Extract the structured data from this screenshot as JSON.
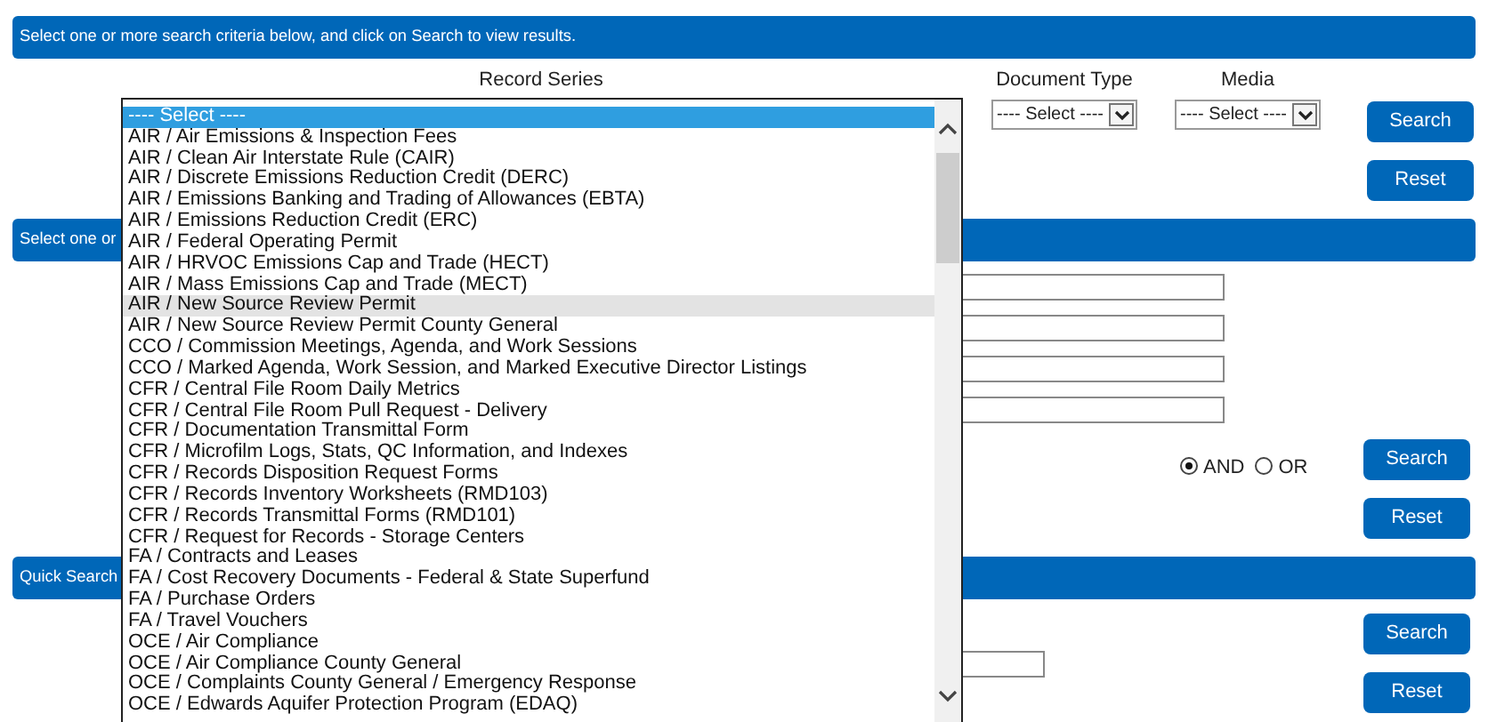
{
  "search_panel": {
    "banner": "Select one or more search criteria below, and click on Search to view results.",
    "record_series": {
      "label": "Record Series"
    },
    "document_type": {
      "label": "Document Type",
      "value": "---- Select ----"
    },
    "media": {
      "label": "Media",
      "value": "---- Select ----"
    },
    "buttons": [
      "Search",
      "Reset"
    ]
  },
  "advanced_panel": {
    "banner": "Select one or",
    "logic_options": [
      {
        "label": "AND",
        "selected": true
      },
      {
        "label": "OR",
        "selected": false
      }
    ],
    "buttons": [
      "Search",
      "Reset"
    ]
  },
  "quick_panel": {
    "banner": "Quick Search",
    "buttons": [
      "Search",
      "Reset"
    ]
  },
  "record_series_list": {
    "items": [
      {
        "label": "---- Select ----",
        "selected": true,
        "hovered": false
      },
      {
        "label": "AIR / Air Emissions & Inspection Fees",
        "selected": false,
        "hovered": false
      },
      {
        "label": "AIR / Clean Air Interstate Rule (CAIR)",
        "selected": false,
        "hovered": false
      },
      {
        "label": "AIR / Discrete Emissions Reduction Credit (DERC)",
        "selected": false,
        "hovered": false
      },
      {
        "label": "AIR / Emissions Banking and Trading of Allowances (EBTA)",
        "selected": false,
        "hovered": false
      },
      {
        "label": "AIR / Emissions Reduction Credit (ERC)",
        "selected": false,
        "hovered": false
      },
      {
        "label": "AIR / Federal Operating Permit",
        "selected": false,
        "hovered": false
      },
      {
        "label": "AIR / HRVOC Emissions Cap and Trade (HECT)",
        "selected": false,
        "hovered": false
      },
      {
        "label": "AIR / Mass Emissions Cap and Trade (MECT)",
        "selected": false,
        "hovered": false
      },
      {
        "label": "AIR / New Source Review Permit",
        "selected": false,
        "hovered": true
      },
      {
        "label": "AIR / New Source Review Permit County General",
        "selected": false,
        "hovered": false
      },
      {
        "label": "CCO / Commission Meetings, Agenda, and Work Sessions",
        "selected": false,
        "hovered": false
      },
      {
        "label": "CCO / Marked Agenda, Work Session, and Marked Executive Director Listings",
        "selected": false,
        "hovered": false
      },
      {
        "label": "CFR / Central File Room Daily Metrics",
        "selected": false,
        "hovered": false
      },
      {
        "label": "CFR / Central File Room Pull Request - Delivery",
        "selected": false,
        "hovered": false
      },
      {
        "label": "CFR / Documentation Transmittal Form",
        "selected": false,
        "hovered": false
      },
      {
        "label": "CFR / Microfilm Logs, Stats, QC Information, and Indexes",
        "selected": false,
        "hovered": false
      },
      {
        "label": "CFR / Records Disposition Request Forms",
        "selected": false,
        "hovered": false
      },
      {
        "label": "CFR / Records Inventory Worksheets (RMD103)",
        "selected": false,
        "hovered": false
      },
      {
        "label": "CFR / Records Transmittal Forms (RMD101)",
        "selected": false,
        "hovered": false
      },
      {
        "label": "CFR / Request for Records - Storage Centers",
        "selected": false,
        "hovered": false
      },
      {
        "label": "FA / Contracts and Leases",
        "selected": false,
        "hovered": false
      },
      {
        "label": "FA / Cost Recovery Documents - Federal & State Superfund",
        "selected": false,
        "hovered": false
      },
      {
        "label": "FA / Purchase Orders",
        "selected": false,
        "hovered": false
      },
      {
        "label": "FA / Travel Vouchers",
        "selected": false,
        "hovered": false
      },
      {
        "label": "OCE / Air Compliance",
        "selected": false,
        "hovered": false
      },
      {
        "label": "OCE / Air Compliance County General",
        "selected": false,
        "hovered": false
      },
      {
        "label": "OCE / Complaints County General / Emergency Response",
        "selected": false,
        "hovered": false
      },
      {
        "label": "OCE / Edwards Aquifer Protection Program (EDAQ)",
        "selected": false,
        "hovered": false
      }
    ]
  }
}
